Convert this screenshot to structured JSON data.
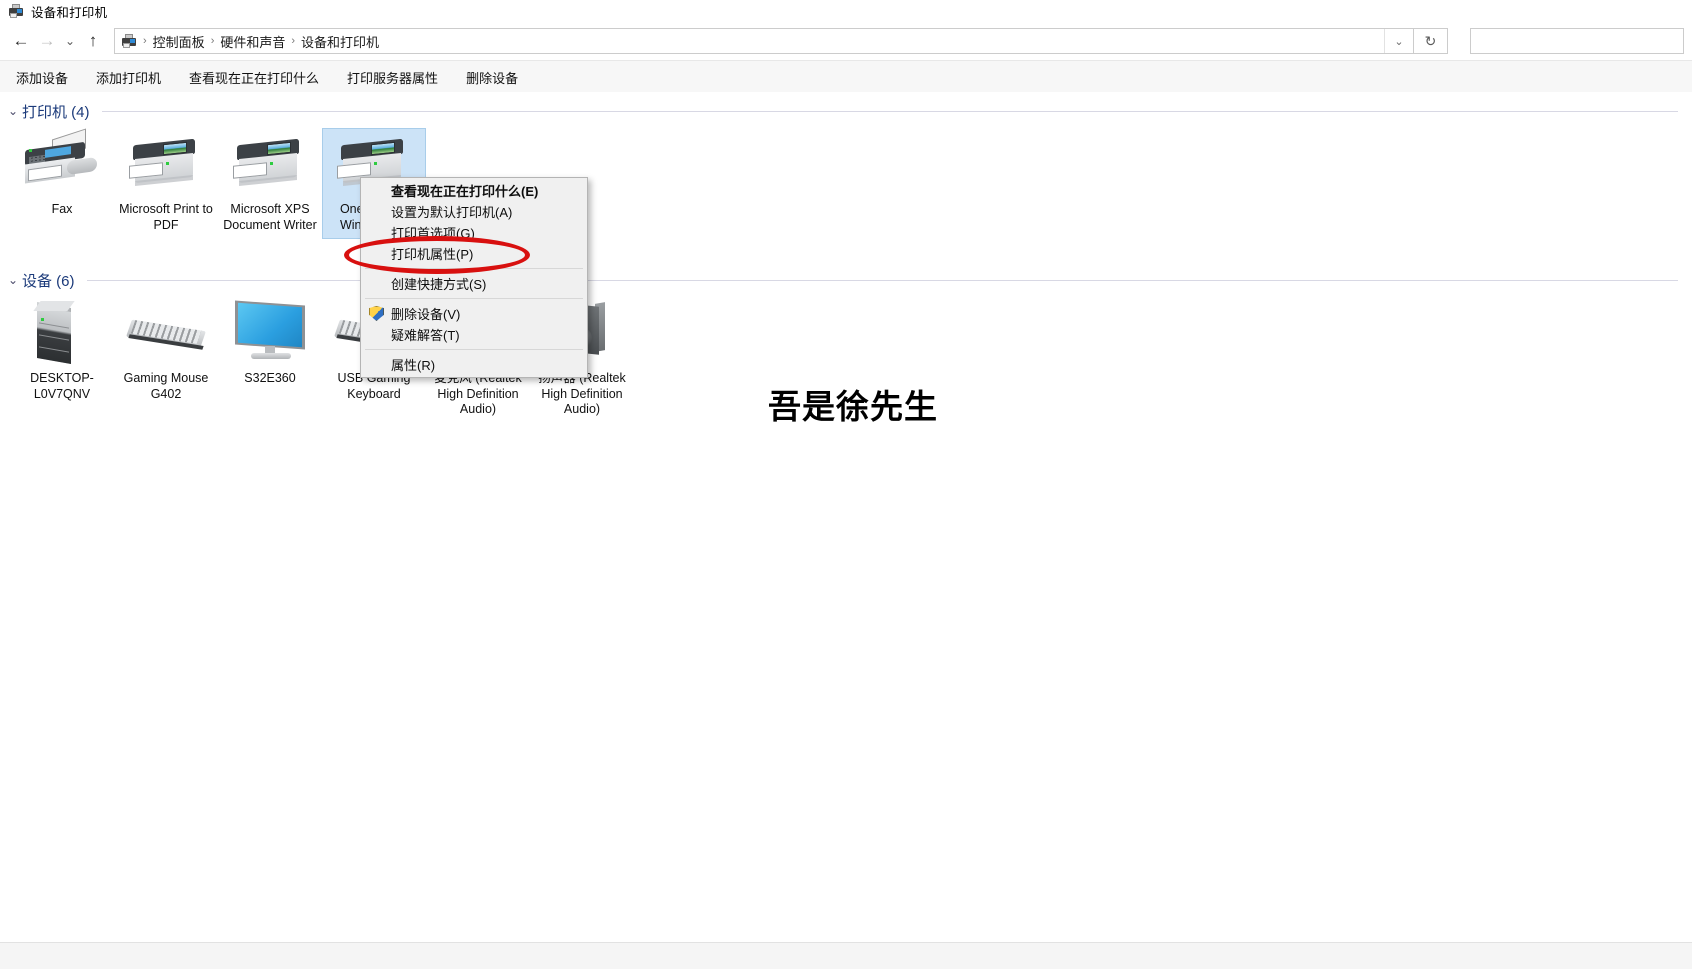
{
  "window": {
    "title": "设备和打印机",
    "title_icon": "devices-printers-icon"
  },
  "nav": {
    "back_icon": "←",
    "forward_icon": "→",
    "recent_icon": "⌄",
    "up_icon": "↑",
    "refresh_icon": "↻",
    "dropdown_icon": "⌄"
  },
  "address": {
    "icon": "devices-printers-icon",
    "separator": "›",
    "crumbs": [
      "控制面板",
      "硬件和声音",
      "设备和打印机"
    ]
  },
  "search": {
    "value": "",
    "placeholder": ""
  },
  "command_bar": {
    "items": [
      "添加设备",
      "添加打印机",
      "查看现在正在打印什么",
      "打印服务器属性",
      "删除设备"
    ]
  },
  "groups": [
    {
      "id": "printers",
      "chevron": "⌄",
      "title": "打印机 (4)",
      "items": [
        {
          "label": "Fax",
          "art": "fax",
          "selected": false
        },
        {
          "label": "Microsoft Print to PDF",
          "art": "printer",
          "selected": false
        },
        {
          "label": "Microsoft XPS Document Writer",
          "art": "printer",
          "selected": false
        },
        {
          "label": "OneNote for Windows 10",
          "art": "printer",
          "selected": true
        }
      ]
    },
    {
      "id": "devices",
      "chevron": "⌄",
      "title": "设备 (6)",
      "items": [
        {
          "label": "DESKTOP-L0V7QNV",
          "art": "tower",
          "selected": false
        },
        {
          "label": "Gaming Mouse G402",
          "art": "keyboard",
          "selected": false
        },
        {
          "label": "S32E360",
          "art": "monitor",
          "selected": false
        },
        {
          "label": "USB Gaming Keyboard",
          "art": "keyboard",
          "selected": false
        },
        {
          "label": "麦克风 (Realtek High Definition Audio)",
          "art": "microphone",
          "selected": false
        },
        {
          "label": "扬声器 (Realtek High Definition Audio)",
          "art": "speaker",
          "selected": false
        }
      ]
    }
  ],
  "context_menu": {
    "items": [
      {
        "label": "查看现在正在打印什么(E)",
        "bold": true,
        "icon": null,
        "separator_after": false
      },
      {
        "label": "设置为默认打印机(A)",
        "bold": false,
        "icon": null,
        "separator_after": false
      },
      {
        "label": "打印首选项(G)",
        "bold": false,
        "icon": null,
        "separator_after": false
      },
      {
        "label": "打印机属性(P)",
        "bold": false,
        "icon": null,
        "separator_after": true
      },
      {
        "label": "创建快捷方式(S)",
        "bold": false,
        "icon": null,
        "separator_after": true
      },
      {
        "label": "删除设备(V)",
        "bold": false,
        "icon": "shield-icon",
        "separator_after": false
      },
      {
        "label": "疑难解答(T)",
        "bold": false,
        "icon": null,
        "separator_after": true
      },
      {
        "label": "属性(R)",
        "bold": false,
        "icon": null,
        "separator_after": false
      }
    ]
  },
  "annotation": {
    "shape": "ellipse",
    "color": "#d8100f",
    "targets": "打印机属性(P)"
  },
  "watermark": {
    "text": "吾是徐先生",
    "color": "#000000"
  },
  "colors": {
    "group_title": "#1b3a7a",
    "selection": "#cce3f7",
    "annotation_red": "#d8100f",
    "command_bar_bg": "#f7f7f7"
  }
}
